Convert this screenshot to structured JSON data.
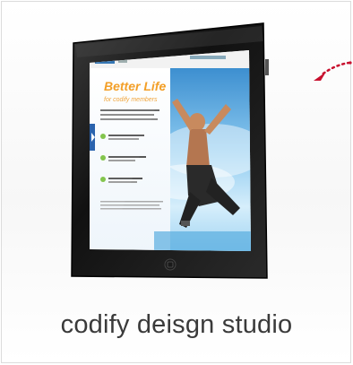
{
  "card": {
    "caption": "codify deisgn studio",
    "screen": {
      "headline_line1": "Better Life",
      "headline_line2": "for codify members"
    }
  },
  "colors": {
    "tablet_frame": "#1a1a1a",
    "screen_sky": "#7ec4ee",
    "headline": "#f39a1b",
    "accent_arrow": "#c8102e",
    "caption_text": "#3a3a3a"
  },
  "icons": {
    "hint_arrow": "dotted-red-arrow-icon",
    "home_button": "home-button-icon"
  }
}
